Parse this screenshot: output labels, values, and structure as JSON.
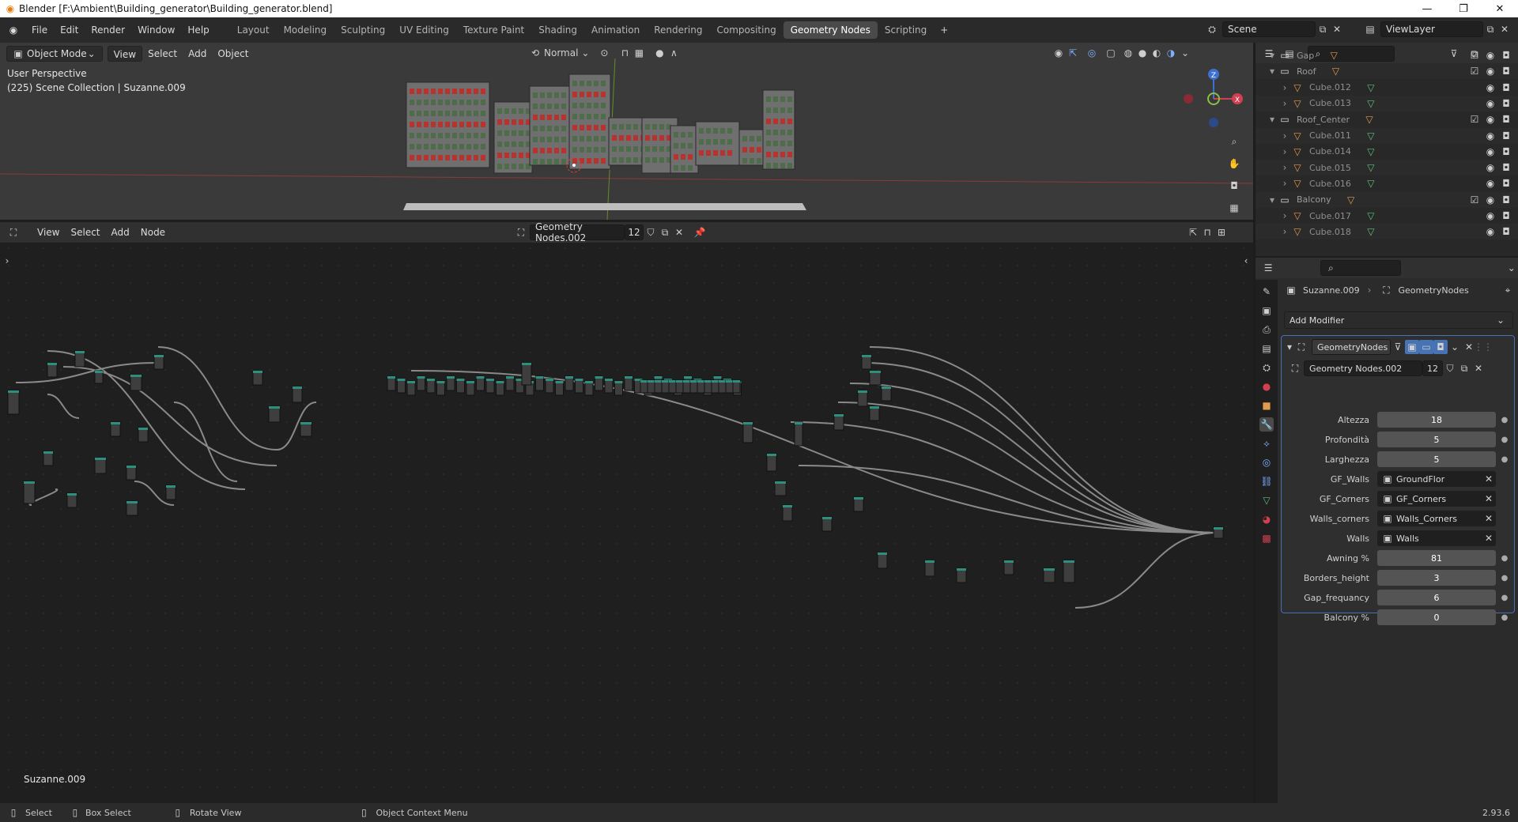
{
  "window": {
    "title": "Blender [F:\\Ambient\\Building_generator\\Building_generator.blend]"
  },
  "menus": [
    "File",
    "Edit",
    "Render",
    "Window",
    "Help"
  ],
  "workspaces": [
    "Layout",
    "Modeling",
    "Sculpting",
    "UV Editing",
    "Texture Paint",
    "Shading",
    "Animation",
    "Rendering",
    "Compositing",
    "Geometry Nodes",
    "Scripting"
  ],
  "active_workspace": "Geometry Nodes",
  "scene": {
    "name": "Scene",
    "view_layer": "ViewLayer"
  },
  "viewport": {
    "mode": "Object Mode",
    "menu": [
      "View",
      "Select",
      "Add",
      "Object"
    ],
    "transform_orientation": "Normal",
    "perspective": "User Perspective",
    "collection_info": "(225) Scene Collection | Suzanne.009",
    "gizmo": {
      "x": "X",
      "y": "Y",
      "z": "Z"
    }
  },
  "outliner": {
    "rows": [
      {
        "name": "Gap",
        "type": "collection",
        "indent": 1,
        "checked": true
      },
      {
        "name": "Roof",
        "type": "collection",
        "indent": 1,
        "checked": true
      },
      {
        "name": "Cube.012",
        "type": "object",
        "indent": 2
      },
      {
        "name": "Cube.013",
        "type": "object",
        "indent": 2
      },
      {
        "name": "Roof_Center",
        "type": "collection",
        "indent": 1,
        "checked": true
      },
      {
        "name": "Cube.011",
        "type": "object",
        "indent": 2
      },
      {
        "name": "Cube.014",
        "type": "object",
        "indent": 2
      },
      {
        "name": "Cube.015",
        "type": "object",
        "indent": 2
      },
      {
        "name": "Cube.016",
        "type": "object",
        "indent": 2
      },
      {
        "name": "Balcony",
        "type": "collection",
        "indent": 1,
        "checked": true
      },
      {
        "name": "Cube.017",
        "type": "object",
        "indent": 2
      },
      {
        "name": "Cube.018",
        "type": "object",
        "indent": 2
      }
    ]
  },
  "node_editor": {
    "menu": [
      "View",
      "Select",
      "Add",
      "Node"
    ],
    "node_tree": "Geometry Nodes.002",
    "users": "12",
    "object_label": "Suzanne.009"
  },
  "properties": {
    "object": "Suzanne.009",
    "modifier_context": "GeometryNodes",
    "add_modifier": "Add Modifier",
    "modifier_name": "GeometryNodes",
    "node_group": "Geometry Nodes.002",
    "node_group_users": "12",
    "inputs": [
      {
        "label": "Altezza",
        "value": "18",
        "kind": "number"
      },
      {
        "label": "Profondità",
        "value": "5",
        "kind": "number"
      },
      {
        "label": "Larghezza",
        "value": "5",
        "kind": "number"
      },
      {
        "label": "GF_Walls",
        "value": "GroundFlor",
        "kind": "object"
      },
      {
        "label": "GF_Corners",
        "value": "GF_Corners",
        "kind": "object"
      },
      {
        "label": "Walls_corners",
        "value": "Walls_Corners",
        "kind": "object"
      },
      {
        "label": "Walls",
        "value": "Walls",
        "kind": "object"
      },
      {
        "label": "Awning %",
        "value": "81",
        "kind": "number"
      },
      {
        "label": "Borders_height",
        "value": "3",
        "kind": "number"
      },
      {
        "label": "Gap_frequancy",
        "value": "6",
        "kind": "number"
      },
      {
        "label": "Balcony %",
        "value": "0",
        "kind": "number"
      }
    ]
  },
  "statusbar": {
    "select": "Select",
    "box_select": "Box Select",
    "rotate_view": "Rotate View",
    "context_menu": "Object Context Menu",
    "version": "2.93.6"
  },
  "colors": {
    "accent": "#4772b3",
    "node_wire": "#8a8a8a",
    "node_header": "#2f8f7f",
    "object_icon": "#e39b4c",
    "mesh_icon": "#5fbf7c"
  }
}
